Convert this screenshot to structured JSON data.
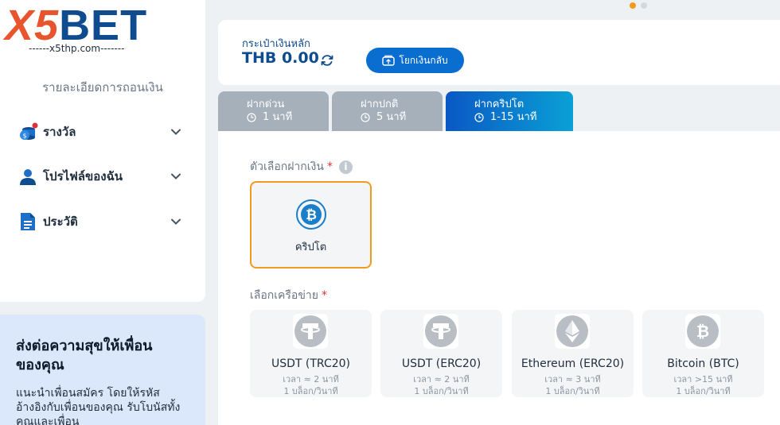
{
  "brand": {
    "logo_x5": "X5",
    "logo_bet": "BET",
    "sub": "------x5thp.com-------"
  },
  "sidebar": {
    "caption": "รายละเอียดการถอนเงิน",
    "items": [
      {
        "label": "รางวัล",
        "icon": "rewards-icon"
      },
      {
        "label": "โปรไฟล์ของฉัน",
        "icon": "user-icon"
      },
      {
        "label": "ประวัติ",
        "icon": "document-icon"
      }
    ]
  },
  "referral": {
    "title": "ส่งต่อความสุขให้เพื่อนของคุณ",
    "desc": "แนะนำเพื่อนสมัคร โดยให้รหัสอ้างอิงกับเพื่อนของคุณ รับโบนัสทั้งคุณและเพื่อน"
  },
  "wallet": {
    "label": "กระเป๋าเงินหลัก",
    "amount": "THB 0.00",
    "transfer_label": "โยกเงินกลับ"
  },
  "tabs": [
    {
      "title": "ฝากด่วน",
      "time": "1 นาที",
      "active": false
    },
    {
      "title": "ฝากปกติ",
      "time": "5 นาที",
      "active": false
    },
    {
      "title": "ฝากคริปโต",
      "time": "1-15 นาที",
      "active": true
    }
  ],
  "deposit": {
    "options_label": "ตัวเลือกฝากเงิน",
    "required_mark": "*",
    "info_glyph": "i",
    "method": {
      "label": "คริปโต",
      "selected": true
    },
    "network_label": "เลือกเครือข่าย",
    "networks": [
      {
        "name": "USDT (TRC20)",
        "time": "เวลา ≈ 2 นาที",
        "rate": "1 บล็อก/วินาที",
        "icon": "tether-icon"
      },
      {
        "name": "USDT (ERC20)",
        "time": "เวลา ≈ 2 นาที",
        "rate": "1 บล็อก/วินาที",
        "icon": "tether-icon"
      },
      {
        "name": "Ethereum (ERC20)",
        "time": "เวลา ≈ 3 นาที",
        "rate": "1 บล็อก/วินาที",
        "icon": "ethereum-icon"
      },
      {
        "name": "Bitcoin (BTC)",
        "time": "เวลา >15 นาที",
        "rate": "1 บล็อก/วินาที",
        "icon": "bitcoin-icon"
      }
    ]
  },
  "colors": {
    "brand_blue": "#0f4b8f",
    "accent_orange": "#f29a1f",
    "button_blue": "#0a6ed1",
    "required_red": "#e0303a"
  }
}
